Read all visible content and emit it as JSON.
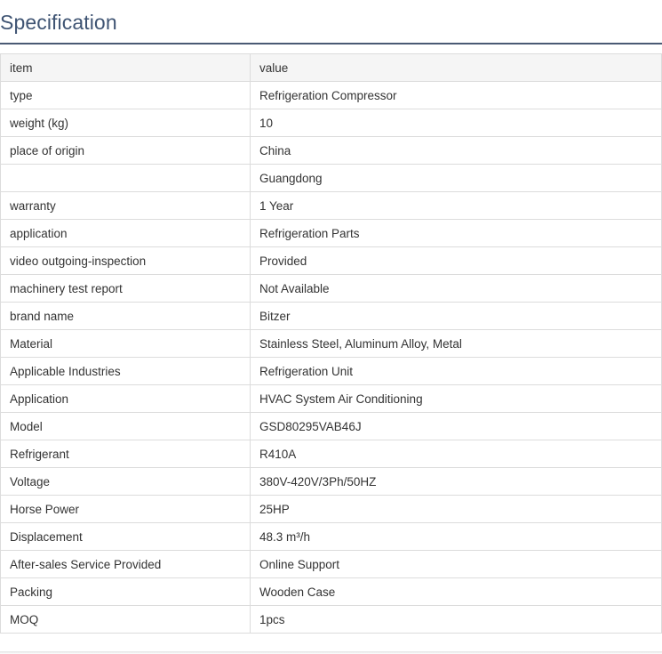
{
  "section": {
    "title": "Specification"
  },
  "table": {
    "header": {
      "item": "item",
      "value": "value"
    },
    "rows": [
      {
        "item": "type",
        "value": "Refrigeration Compressor"
      },
      {
        "item": "weight (kg)",
        "value": "10"
      },
      {
        "item": "place of origin",
        "value": "China"
      },
      {
        "item": "",
        "value": "Guangdong"
      },
      {
        "item": "warranty",
        "value": "1 Year"
      },
      {
        "item": "application",
        "value": "Refrigeration Parts"
      },
      {
        "item": "video outgoing-inspection",
        "value": "Provided"
      },
      {
        "item": "machinery test report",
        "value": "Not Available"
      },
      {
        "item": "brand name",
        "value": "Bitzer"
      },
      {
        "item": "Material",
        "value": "Stainless Steel, Aluminum Alloy, Metal"
      },
      {
        "item": "Applicable Industries",
        "value": "Refrigeration Unit"
      },
      {
        "item": "Application",
        "value": "HVAC System Air Conditioning"
      },
      {
        "item": "Model",
        "value": "GSD80295VAB46J"
      },
      {
        "item": "Refrigerant",
        "value": "R410A"
      },
      {
        "item": "Voltage",
        "value": "380V-420V/3Ph/50HZ"
      },
      {
        "item": "Horse Power",
        "value": "25HP"
      },
      {
        "item": "Displacement",
        "value": "48.3 m³/h"
      },
      {
        "item": "After-sales Service Provided",
        "value": "Online Support"
      },
      {
        "item": "Packing",
        "value": "Wooden Case"
      },
      {
        "item": "MOQ",
        "value": "1pcs"
      }
    ]
  }
}
